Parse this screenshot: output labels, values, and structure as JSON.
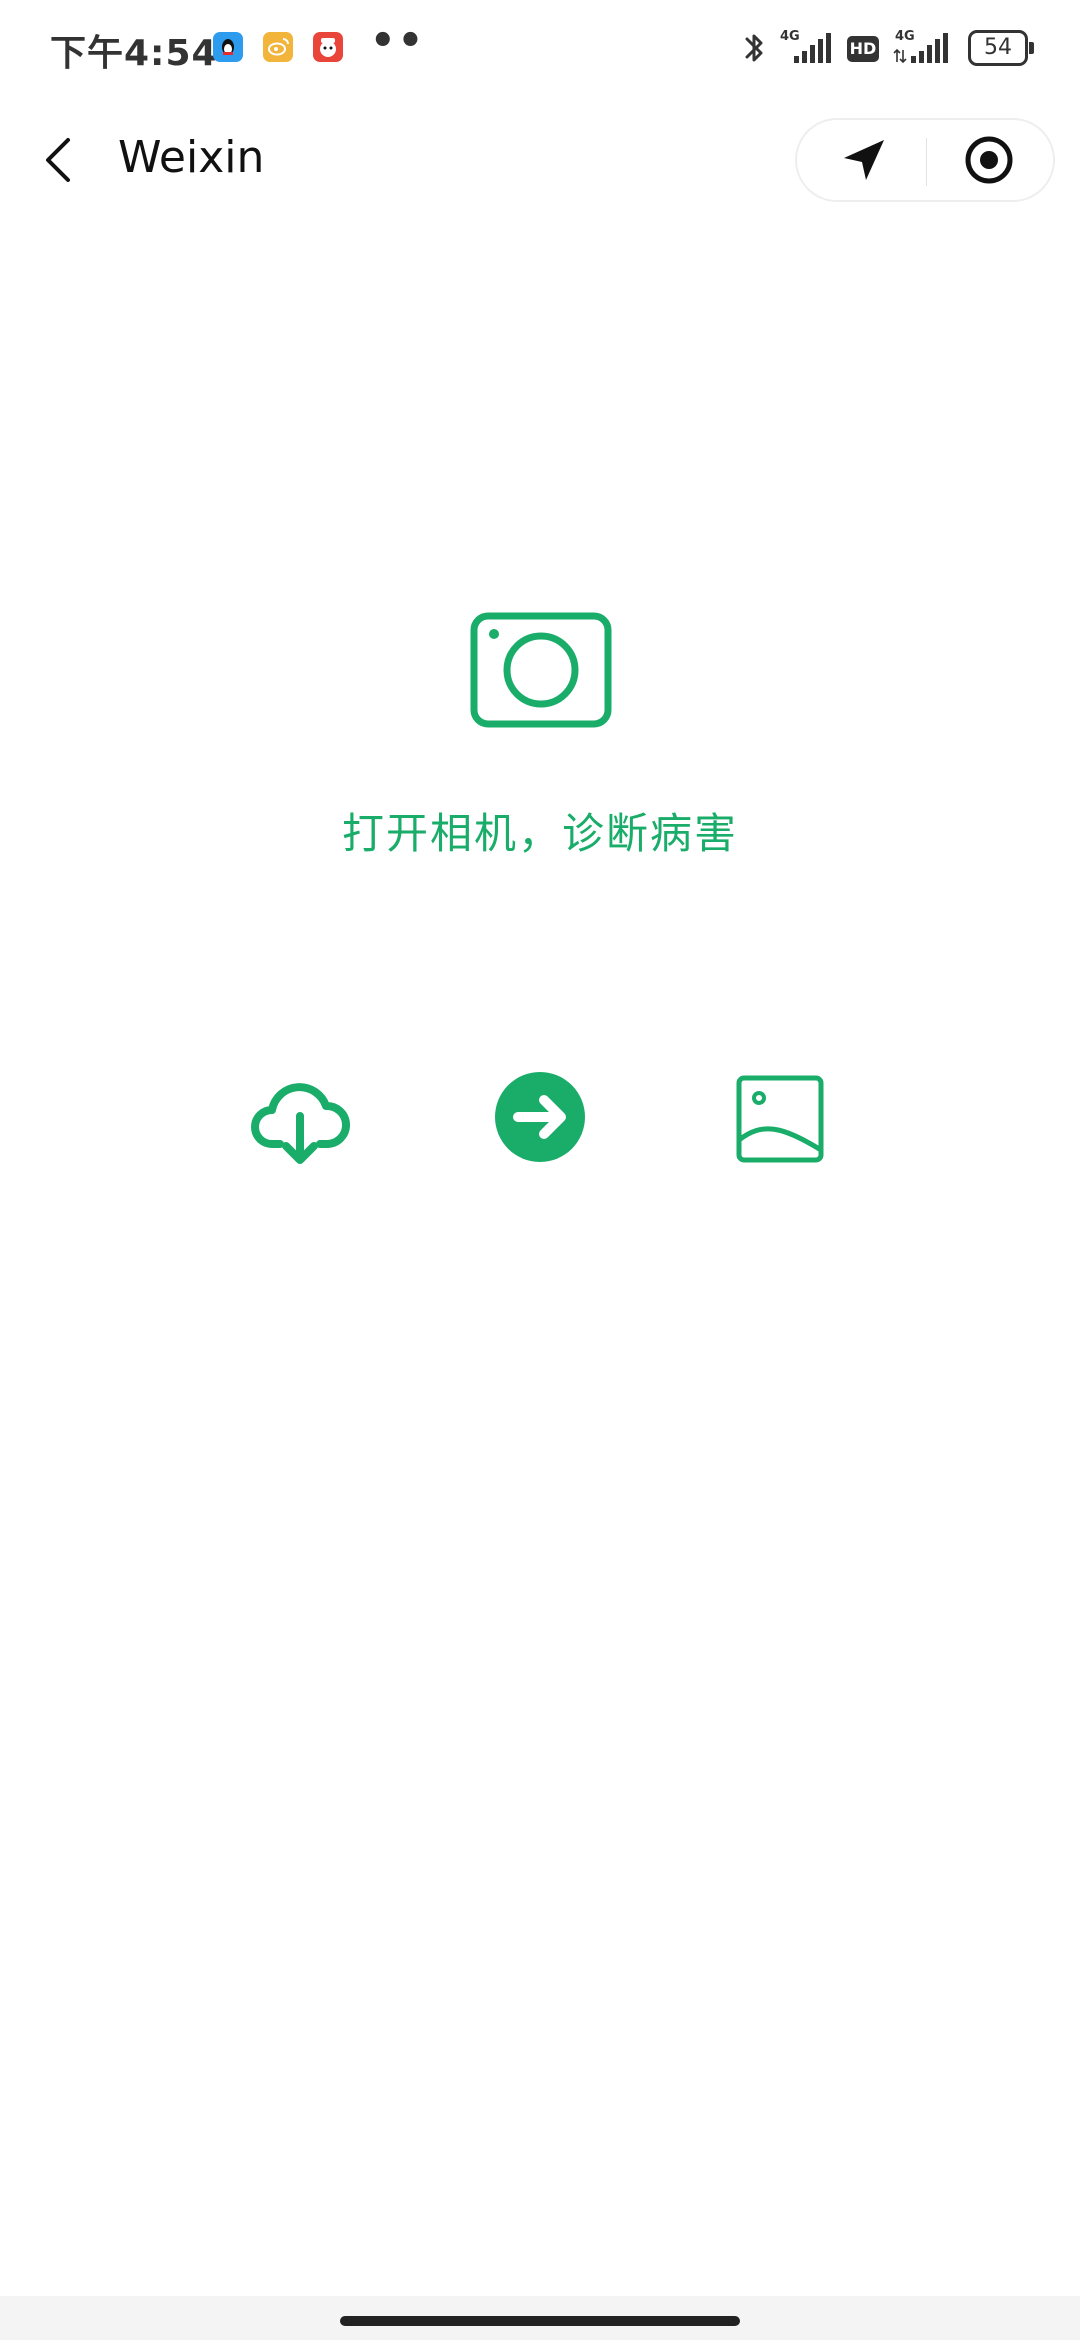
{
  "status_bar": {
    "time": "下午4:54",
    "more_indicator": "••",
    "network_1": "4G",
    "network_2": "4G",
    "hd_label": "HD",
    "battery_level": "54",
    "notification_icons": [
      "qq-icon",
      "weibo-icon",
      "app-icon"
    ]
  },
  "nav": {
    "title": "Weixin",
    "back_icon": "chevron-left-icon",
    "capsule_icons": [
      "location-arrow-icon",
      "record-circle-icon"
    ]
  },
  "main": {
    "caption": "打开相机，诊断病害",
    "camera_icon": "camera-icon",
    "actions": [
      "cloud-download-icon",
      "arrow-right-circle-icon",
      "image-icon"
    ]
  },
  "colors": {
    "accent": "#1aad6a",
    "text": "#111111",
    "status_text": "#333333"
  }
}
